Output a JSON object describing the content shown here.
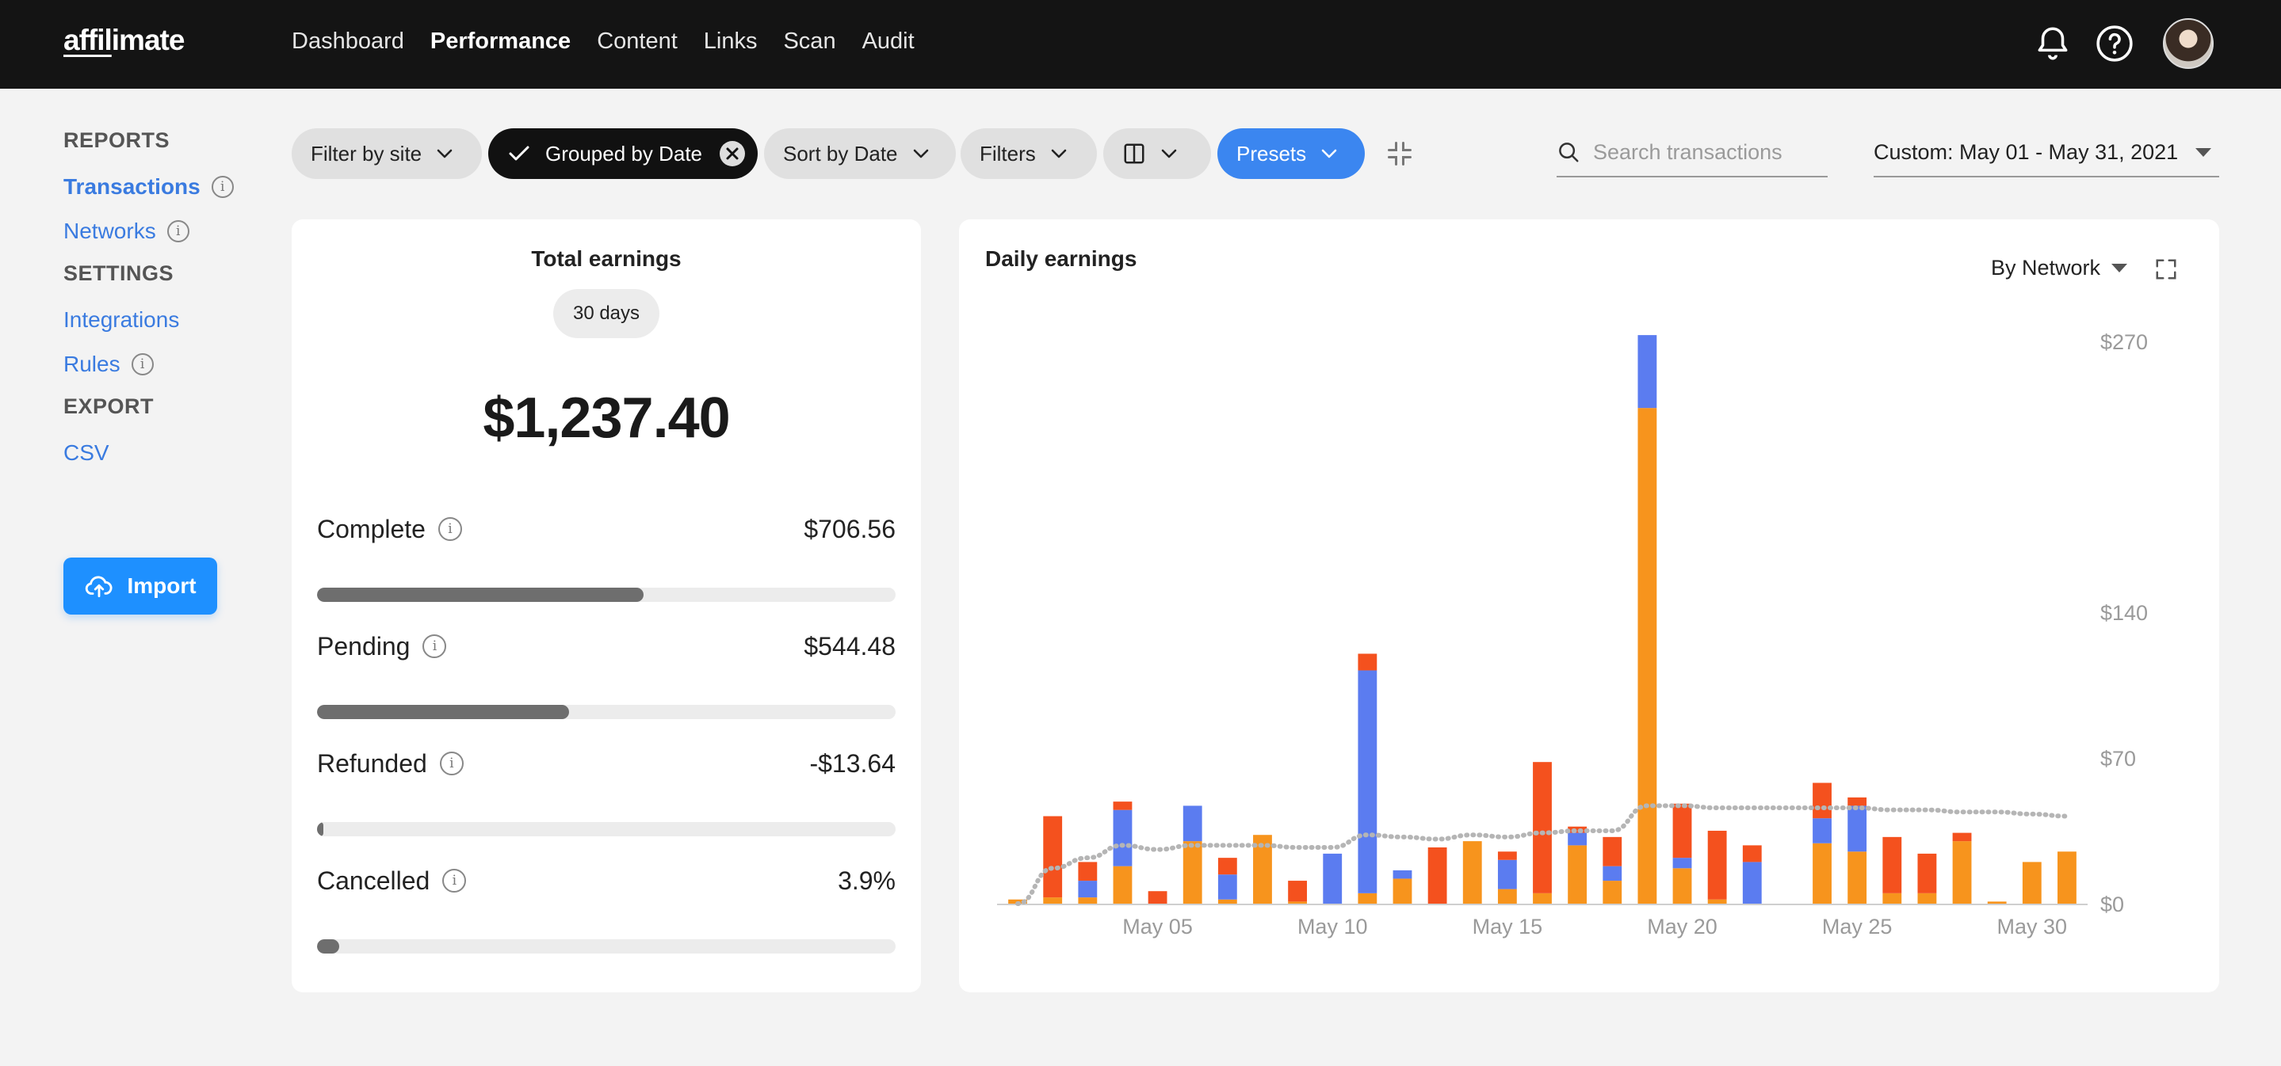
{
  "app": {
    "logo_pre": "affil",
    "logo_post": "imate"
  },
  "nav": {
    "items": [
      {
        "label": "Dashboard",
        "active": false
      },
      {
        "label": "Performance",
        "active": true
      },
      {
        "label": "Content",
        "active": false
      },
      {
        "label": "Links",
        "active": false
      },
      {
        "label": "Scan",
        "active": false
      },
      {
        "label": "Audit",
        "active": false
      }
    ]
  },
  "icons": {
    "bell": "bell-icon",
    "help": "help-icon",
    "search": "search-icon",
    "upload": "cloud-upload-icon",
    "compress": "compress-icon",
    "expand": "expand-icon",
    "columns": "columns-icon",
    "check": "check-icon",
    "clear": "clear-circle-icon"
  },
  "sidebar": {
    "reports_head": "REPORTS",
    "transactions": "Transactions",
    "networks": "Networks",
    "settings_head": "SETTINGS",
    "integrations": "Integrations",
    "rules": "Rules",
    "export_head": "EXPORT",
    "csv": "CSV",
    "import_label": "Import"
  },
  "toolbar": {
    "filter_site": "Filter by site",
    "grouped": "Grouped by Date",
    "sort": "Sort by Date",
    "filters": "Filters",
    "presets": "Presets",
    "search_placeholder": "Search transactions",
    "date_range": "Custom: May 01 - May 31, 2021"
  },
  "earnings": {
    "title": "Total earnings",
    "period": "30 days",
    "total": "$1,237.40",
    "stats": [
      {
        "label": "Complete",
        "value": "$706.56",
        "fraction": 0.565
      },
      {
        "label": "Pending",
        "value": "$544.48",
        "fraction": 0.435
      },
      {
        "label": "Refunded",
        "value": "-$13.64",
        "fraction": 0.011
      },
      {
        "label": "Cancelled",
        "value": "3.9%",
        "fraction": 0.039
      }
    ]
  },
  "colors": {
    "orange": "#f7941d",
    "red": "#f4511e",
    "blue": "#5b7cf0",
    "line": "#b5b5b5",
    "accent": "#3b86f0"
  },
  "chart_header": {
    "title": "Daily earnings",
    "group_by": "By Network"
  },
  "chart_data": {
    "type": "bar",
    "stacked": true,
    "title": "Daily earnings",
    "ylim": [
      0,
      270
    ],
    "y_ticks": [
      0,
      70,
      140,
      270
    ],
    "y_tick_labels": [
      "$0",
      "$70",
      "$140",
      "$270"
    ],
    "x_tick_labels": [
      {
        "day": 5,
        "label": "May 05"
      },
      {
        "day": 10,
        "label": "May 10"
      },
      {
        "day": 15,
        "label": "May 15"
      },
      {
        "day": 20,
        "label": "May 20"
      },
      {
        "day": 25,
        "label": "May 25"
      },
      {
        "day": 30,
        "label": "May 30"
      }
    ],
    "x": [
      1,
      2,
      3,
      4,
      5,
      6,
      7,
      8,
      9,
      10,
      11,
      12,
      13,
      14,
      15,
      16,
      17,
      18,
      19,
      20,
      21,
      22,
      23,
      24,
      25,
      26,
      27,
      28,
      29,
      30,
      31
    ],
    "series": [
      {
        "color_key": "orange",
        "values": [
          2,
          3,
          3,
          18,
          0,
          30,
          2,
          33,
          1,
          0,
          5,
          12,
          0,
          30,
          7,
          5,
          28,
          11,
          238,
          17,
          2,
          0,
          0,
          29,
          25,
          5,
          5,
          30,
          1,
          20,
          25
        ]
      },
      {
        "color_key": "blue",
        "values": [
          0,
          0,
          8,
          27,
          0,
          17,
          12,
          0,
          0,
          24,
          107,
          4,
          0,
          0,
          14,
          0,
          6,
          7,
          35,
          5,
          0,
          20,
          0,
          12,
          22,
          0,
          0,
          0,
          0,
          0,
          0
        ]
      },
      {
        "color_key": "red",
        "values": [
          0,
          39,
          9,
          4,
          6,
          0,
          8,
          0,
          10,
          0,
          8,
          0,
          27,
          0,
          4,
          63,
          3,
          14,
          0,
          26,
          33,
          8,
          0,
          17,
          4,
          27,
          19,
          4,
          0,
          0,
          0
        ]
      }
    ],
    "trend_line": [
      0,
      17,
      22,
      28,
      26,
      28,
      28,
      28,
      27,
      27,
      33,
      32,
      31,
      33,
      32,
      34,
      35,
      35,
      47,
      47,
      46,
      46,
      46,
      46,
      46,
      45,
      45,
      44,
      44,
      43,
      42
    ]
  }
}
